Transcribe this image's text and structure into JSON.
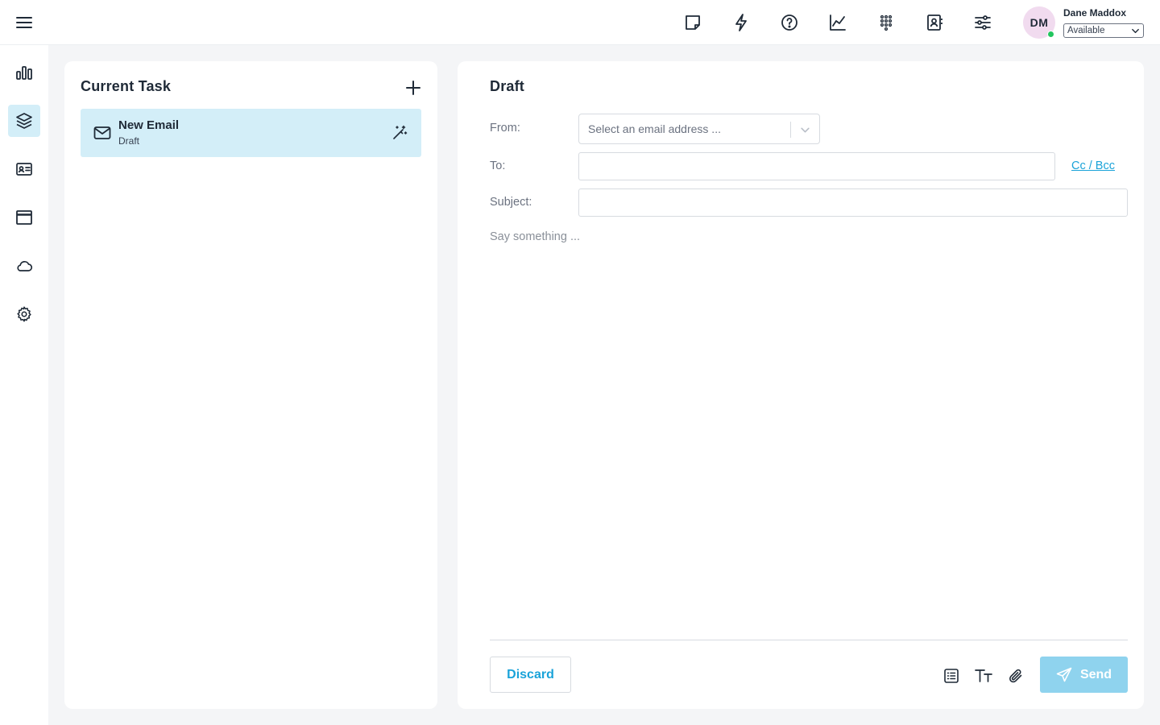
{
  "topbar": {
    "icons": [
      "hamburger-icon",
      "sticky-note-icon",
      "lightning-icon",
      "help-icon",
      "analytics-icon",
      "dialpad-icon",
      "contacts-icon",
      "settings-sliders-icon"
    ],
    "user": {
      "initials": "DM",
      "name": "Dane Maddox",
      "status": "Available",
      "status_dot_color": "#22c55e"
    }
  },
  "sidenav": {
    "items": [
      {
        "icon": "bar-chart-icon",
        "active": false
      },
      {
        "icon": "layers-icon",
        "active": true
      },
      {
        "icon": "contact-card-icon",
        "active": false
      },
      {
        "icon": "window-icon",
        "active": false
      },
      {
        "icon": "cloud-icon",
        "active": false
      },
      {
        "icon": "gear-icon",
        "active": false
      }
    ]
  },
  "task_panel": {
    "title": "Current Task",
    "tasks": [
      {
        "name": "New Email",
        "status": "Draft"
      }
    ]
  },
  "draft": {
    "title": "Draft",
    "from_label": "From:",
    "from_placeholder": "Select an email address ...",
    "to_label": "To:",
    "to_value": "",
    "cc_bcc_label": "Cc / Bcc",
    "subject_label": "Subject:",
    "subject_value": "",
    "body_placeholder": "Say something ...",
    "discard_label": "Discard",
    "send_label": "Send"
  },
  "colors": {
    "accent": "#1aa3d9",
    "active_bg": "#d3eef8",
    "send_bg": "#8fd3ee",
    "page_bg": "#f4f5f7"
  }
}
